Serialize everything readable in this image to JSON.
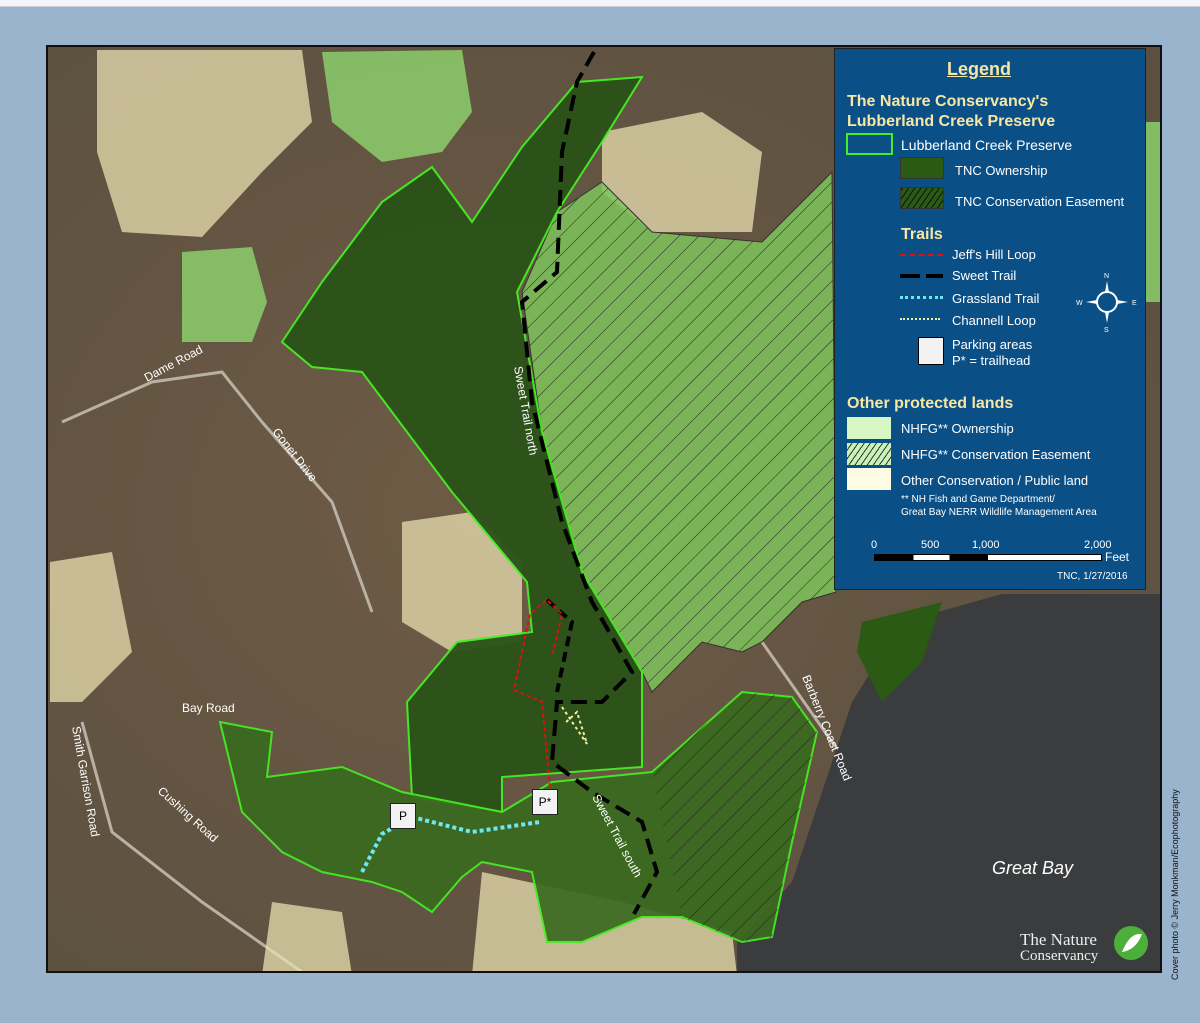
{
  "legend": {
    "title": "Legend",
    "preserve_heading_1": "The Nature Conservancy's",
    "preserve_heading_2": "Lubberland Creek Preserve",
    "items": {
      "preserve": "Lubberland Creek Preserve",
      "tnc_ownership": "TNC Ownership",
      "tnc_easement": "TNC Conservation Easement"
    },
    "trails_heading": "Trails",
    "trails": {
      "jeffs": "Jeff's Hill Loop",
      "sweet": "Sweet Trail",
      "grassland": "Grassland Trail",
      "channell": "Channell Loop"
    },
    "parking_1": "Parking areas",
    "parking_2": "P* = trailhead",
    "compass": {
      "n": "N",
      "s": "S",
      "e": "E",
      "w": "W"
    },
    "other_heading": "Other protected lands",
    "other": {
      "nhfg_own": "NHFG** Ownership",
      "nhfg_ease": "NHFG** Conservation Easement",
      "other_public": "Other Conservation / Public land"
    },
    "footnote_1": "** NH Fish and Game Department/",
    "footnote_2": "Great Bay NERR Wildlife Management Area",
    "scale": {
      "t0": "0",
      "t1": "500",
      "t2": "1,000",
      "t3": "2,000",
      "unit": "Feet"
    },
    "date": "TNC, 1/27/2016"
  },
  "labels": {
    "dame": "Dame Road",
    "gonet": "Gonet Drive",
    "bay": "Bay Road",
    "smith": "Smith Garrison Road",
    "cushing": "Cushing Road",
    "barberry": "Barberry Coast Road",
    "sweet_north": "Sweet Trail north",
    "sweet_south": "Sweet Trail south",
    "great_bay": "Great Bay",
    "parking": "P",
    "trailhead": "P*"
  },
  "logo": {
    "line1": "The Nature",
    "line2": "Conservancy"
  },
  "credit": "Cover photo © Jerry Monkman/Ecophotography",
  "colors": {
    "legend_bg": "#0a4f86",
    "preserve_outline": "#44ee22",
    "tnc": "#2a5a14",
    "nhfg": "#c9f2b8",
    "other": "#f7f2d4"
  }
}
